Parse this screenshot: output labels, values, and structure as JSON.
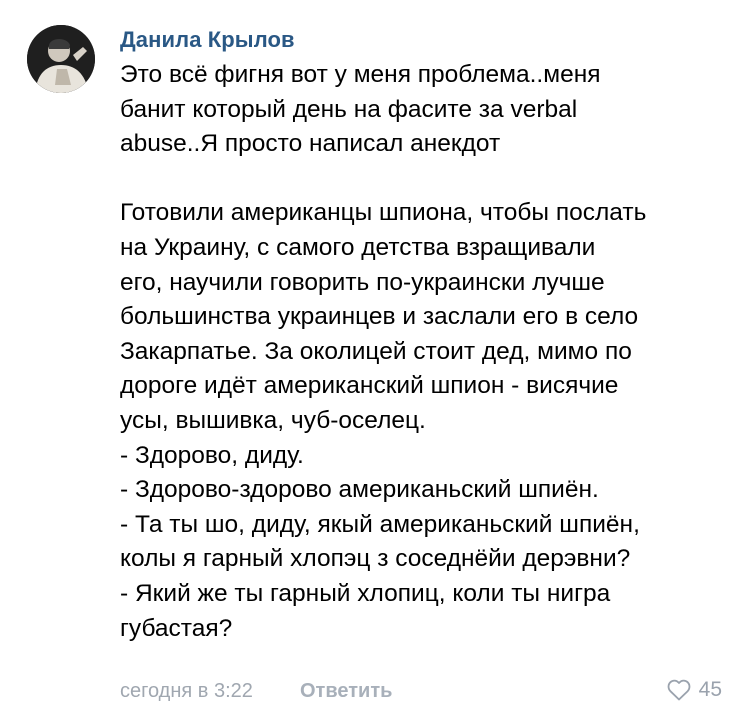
{
  "comment": {
    "author": "Данила Крылов",
    "lines": [
      "Это всё фигня вот у меня проблема..меня",
      "банит который день на фасите за verbal",
      "abuse..Я просто написал анекдот",
      "",
      "Готовили американцы шпиона, чтобы послать",
      "на Украину, с самого детства взращивали",
      "его, научили говорить по-украински лучше",
      "большинства украинцев и заслали его в село",
      "Закарпатье. За околицей стоит дед, мимо по",
      "дороге идёт американский шпион - висячие",
      "усы, вышивка, чуб-оселец.",
      "- Здорово, диду.",
      "- Здорово-здорово американьский шпиён.",
      "- Та ты шо, диду, якый американьский шпиён,",
      "колы я гарный хлопэц з соседнёйи дерэвни?",
      "- Який же ты гарный хлопиц, коли ты нигра",
      "губастая?"
    ],
    "date": "сегодня в 3:22",
    "reply_label": "Ответить",
    "likes_count": "45",
    "like_icon": "heart-outline-icon"
  },
  "colors": {
    "author": "#2a5885",
    "meta": "#a0a7b0",
    "text": "#000000",
    "background": "#ffffff"
  }
}
